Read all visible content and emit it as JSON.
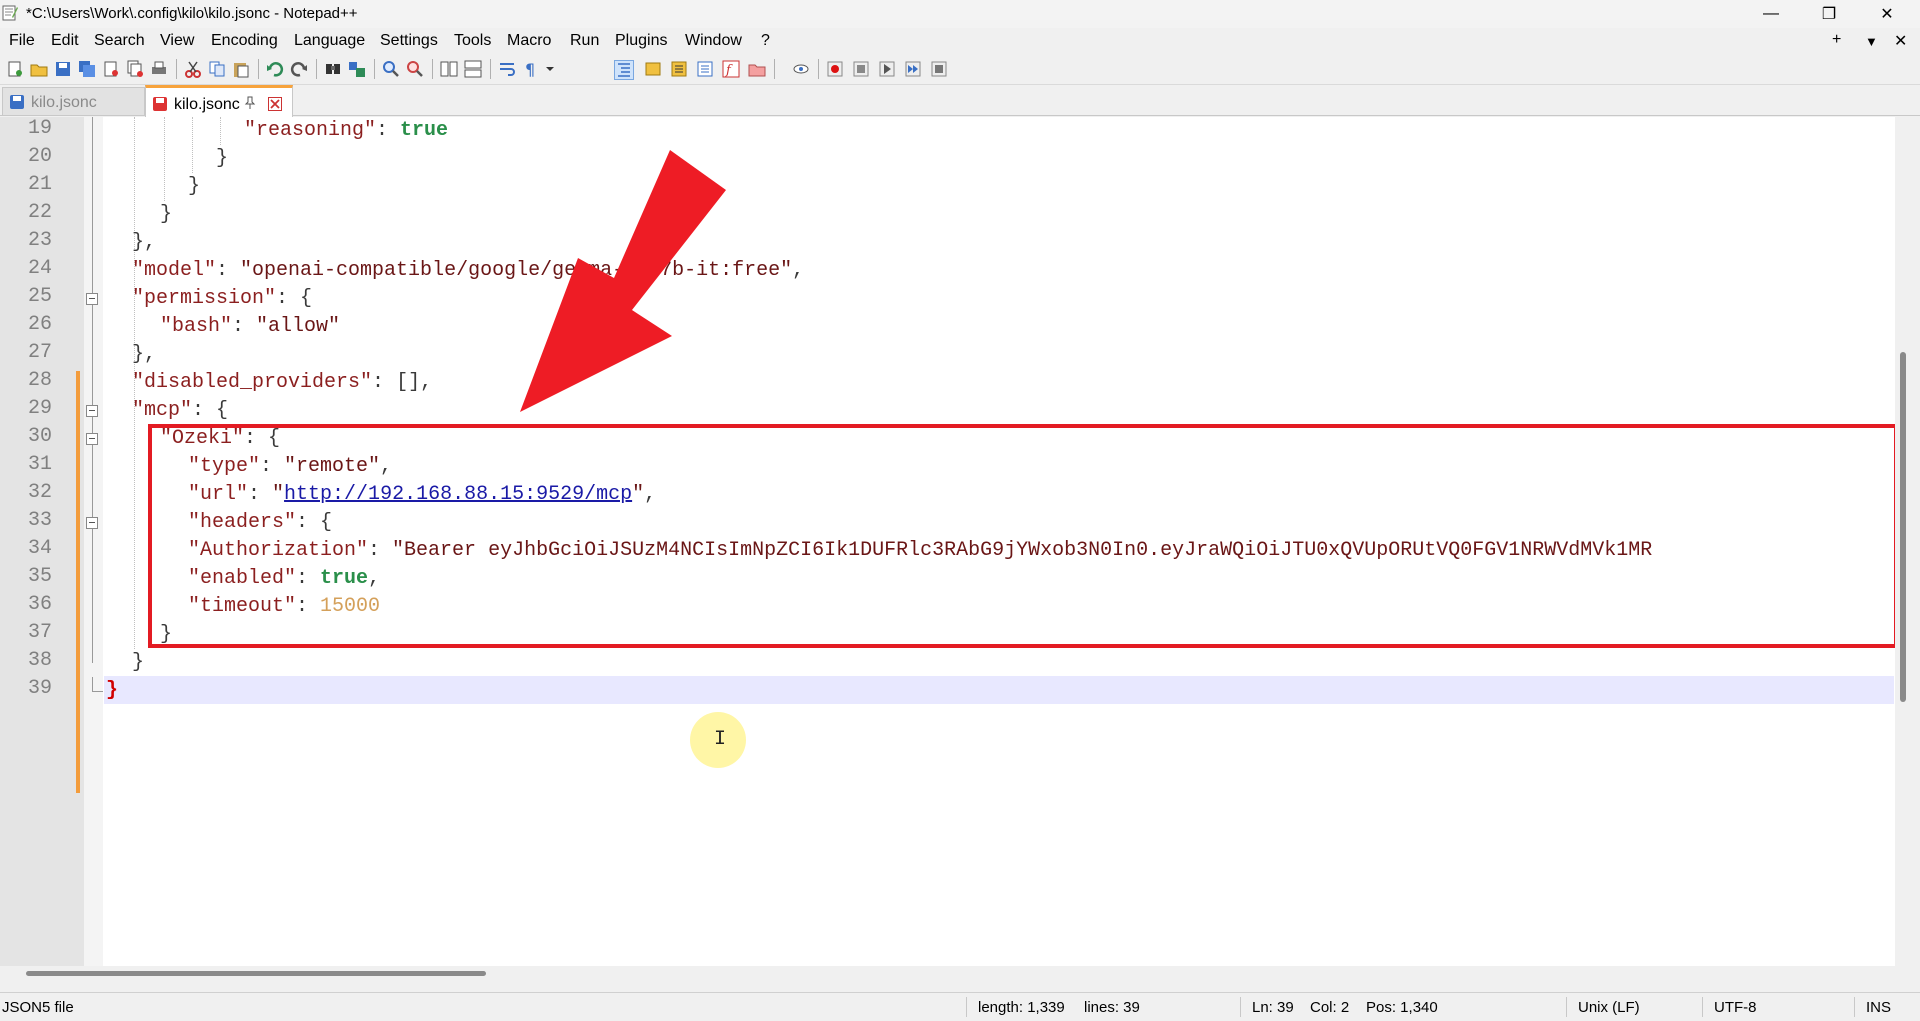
{
  "window": {
    "title": "*C:\\Users\\Work\\.config\\kilo\\kilo.jsonc - Notepad++"
  },
  "menu": [
    "File",
    "Edit",
    "Search",
    "View",
    "Encoding",
    "Language",
    "Settings",
    "Tools",
    "Macro",
    "Run",
    "Plugins",
    "Window",
    "?"
  ],
  "menu_right": {
    "add": "+",
    "dropdown": "▼",
    "close": "✕"
  },
  "tabs": [
    {
      "label": "kilo.jsonc",
      "active": false
    },
    {
      "label": "kilo.jsonc",
      "active": true
    }
  ],
  "line_numbers": [
    "19",
    "20",
    "21",
    "22",
    "23",
    "24",
    "25",
    "26",
    "27",
    "28",
    "29",
    "30",
    "31",
    "32",
    "33",
    "34",
    "35",
    "36",
    "37",
    "38",
    "39"
  ],
  "code": {
    "l19": {
      "key": "\"reasoning\"",
      "val": "true"
    },
    "l20": "}",
    "l21": "}",
    "l22": "}",
    "l23": "},",
    "l24": {
      "key": "\"model\"",
      "val": "\"openai-compatible/google/gemma-3-27b-it:free\""
    },
    "l25": {
      "key": "\"permission\"",
      "val": "{"
    },
    "l26": {
      "key": "\"bash\"",
      "val": "\"allow\""
    },
    "l27": "},",
    "l28": {
      "key": "\"disabled_providers\"",
      "val": "[]"
    },
    "l29": {
      "key": "\"mcp\"",
      "val": "{"
    },
    "l30": {
      "key": "\"Ozeki\"",
      "val": "{"
    },
    "l31": {
      "key": "\"type\"",
      "val": "\"remote\""
    },
    "l32": {
      "key": "\"url\"",
      "val_pre": "\"",
      "url": "http://192.168.88.15:9529/mcp",
      "val_post": "\""
    },
    "l33": {
      "key": "\"headers\"",
      "val": "{"
    },
    "l34": {
      "key": "\"Authorization\"",
      "val": "\"Bearer eyJhbGciOiJSUzM4NCIsImNpZCI6Ik1DUFRlc3RAbG9jYWxob3N0In0.eyJraWQiOiJTU0xQVUpORUtVQ0FGV1NRWVdMVk1MR"
    },
    "l35": {
      "key": "\"enabled\"",
      "val": "true"
    },
    "l36": {
      "key": "\"timeout\"",
      "val": "15000"
    },
    "l37": "}",
    "l38": "}",
    "l39": "}"
  },
  "status": {
    "file_type": "JSON5 file",
    "length": "length: 1,339",
    "lines": "lines: 39",
    "ln": "Ln: 39",
    "col": "Col: 2",
    "pos": "Pos: 1,340",
    "eol": "Unix (LF)",
    "encoding": "UTF-8",
    "mode": "INS"
  },
  "colors": {
    "annotation_red": "#e31b23",
    "tab_accent": "#f7a33c",
    "change_bar": "#f39c3c"
  }
}
